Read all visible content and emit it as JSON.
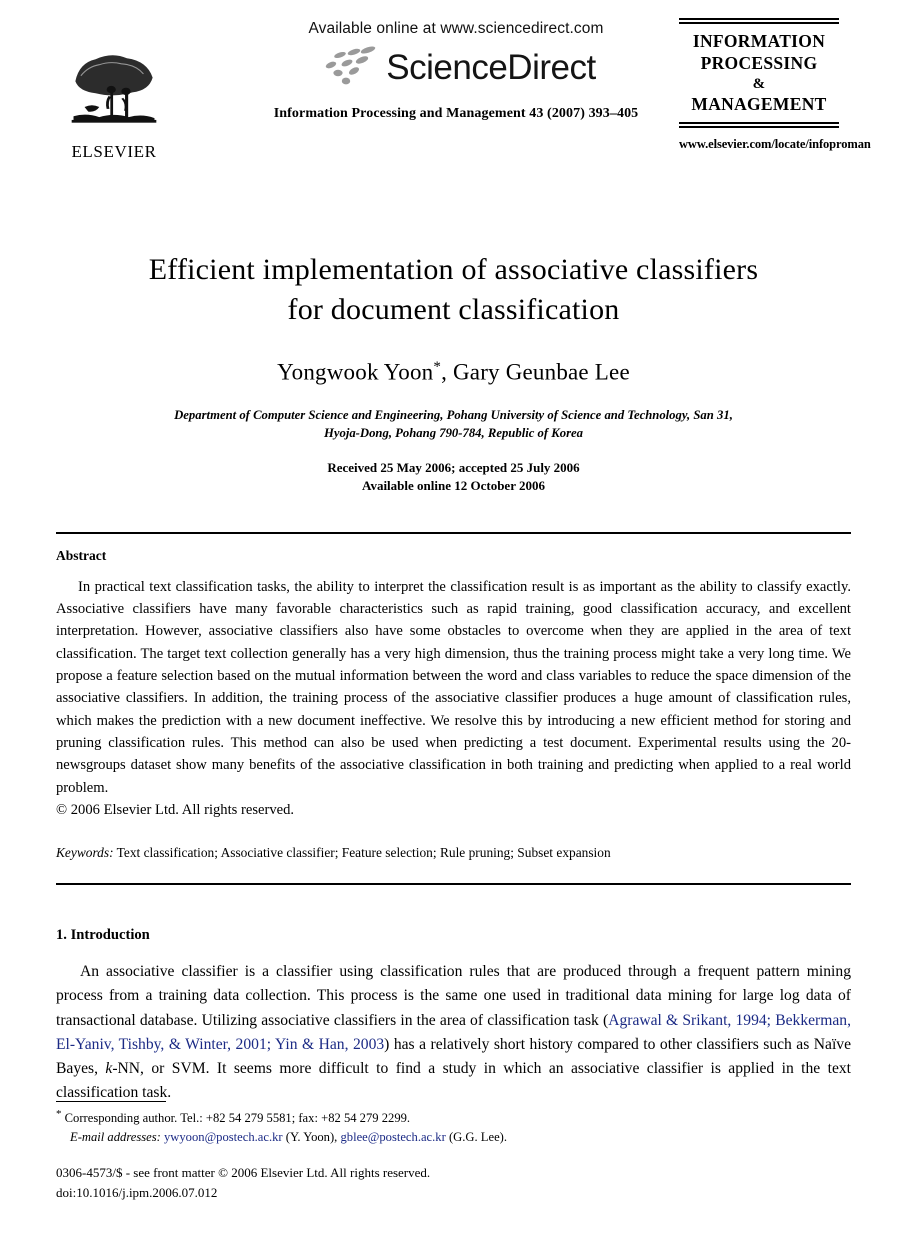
{
  "masthead": {
    "publisher_name": "ELSEVIER",
    "publisher_logo_icon": "elsevier-tree-icon",
    "available_online": "Available online at www.sciencedirect.com",
    "sciencedirect_wordmark": "ScienceDirect",
    "sciencedirect_logo_icon": "sciencedirect-swoosh-icon",
    "journal_reference": "Information Processing and Management 43 (2007) 393–405",
    "journal_box": {
      "line1": "INFORMATION",
      "line2": "PROCESSING",
      "line3": "&",
      "line4": "MANAGEMENT"
    },
    "journal_url": "www.elsevier.com/locate/infoproman"
  },
  "title": {
    "line1": "Efficient implementation of associative classifiers",
    "line2": "for document classification"
  },
  "authors": {
    "names": "Yongwook Yoon",
    "corresponding_marker": "*",
    "names_rest": ", Gary Geunbae Lee"
  },
  "affiliation": {
    "line1": "Department of Computer Science and Engineering, Pohang University of Science and Technology, San 31,",
    "line2": "Hyoja-Dong, Pohang 790-784, Republic of Korea"
  },
  "dates": {
    "received": "Received 25 May 2006; accepted 25 July 2006",
    "available": "Available online 12 October 2006"
  },
  "abstract": {
    "heading": "Abstract",
    "text": "In practical text classification tasks, the ability to interpret the classification result is as important as the ability to classify exactly. Associative classifiers have many favorable characteristics such as rapid training, good classification accuracy, and excellent interpretation. However, associative classifiers also have some obstacles to overcome when they are applied in the area of text classification. The target text collection generally has a very high dimension, thus the training process might take a very long time. We propose a feature selection based on the mutual information between the word and class variables to reduce the space dimension of the associative classifiers. In addition, the training process of the associative classifier produces a huge amount of classification rules, which makes the prediction with a new document ineffective. We resolve this by introducing a new efficient method for storing and pruning classification rules. This method can also be used when predicting a test document. Experimental results using the 20-newsgroups dataset show many benefits of the associative classification in both training and predicting when applied to a real world problem.",
    "copyright": "© 2006 Elsevier Ltd. All rights reserved."
  },
  "keywords": {
    "label": "Keywords:",
    "value": "Text classification; Associative classifier; Feature selection; Rule pruning; Subset expansion"
  },
  "introduction": {
    "heading": "1. Introduction",
    "para_part1": "An associative classifier is a classifier using classification rules that are produced through a frequent pattern mining process from a training data collection. This process is the same one used in traditional data mining for large log data of transactional database. Utilizing associative classifiers in the area of classification task (",
    "citation1": "Agrawal & Srikant, 1994;",
    "citation2": "Bekkerman, El-Yaniv, Tishby, & Winter, 2001;",
    "citation3": "Yin & Han, 2003",
    "para_part2": ") has a relatively short history compared to other classifiers such as Naïve Bayes, ",
    "para_italic_k": "k",
    "para_part3": "-NN, or SVM. It seems more difficult to find a study in which an associative classifier is applied in the text classification task."
  },
  "footnotes": {
    "marker": "*",
    "corresponding": "Corresponding author. Tel.: +82 54 279 5581; fax: +82 54 279 2299.",
    "email_label": "E-mail addresses:",
    "email1": "ywyoon@postech.ac.kr",
    "email1_owner": "(Y. Yoon),",
    "email2": "gblee@postech.ac.kr",
    "email2_owner": "(G.G. Lee)."
  },
  "footer": {
    "issn_line": "0306-4573/$ - see front matter © 2006 Elsevier Ltd. All rights reserved.",
    "doi_line": "doi:10.1016/j.ipm.2006.07.012"
  },
  "colors": {
    "link": "#1b2a85",
    "text": "#000000",
    "swoosh": "#9a9a9a"
  }
}
